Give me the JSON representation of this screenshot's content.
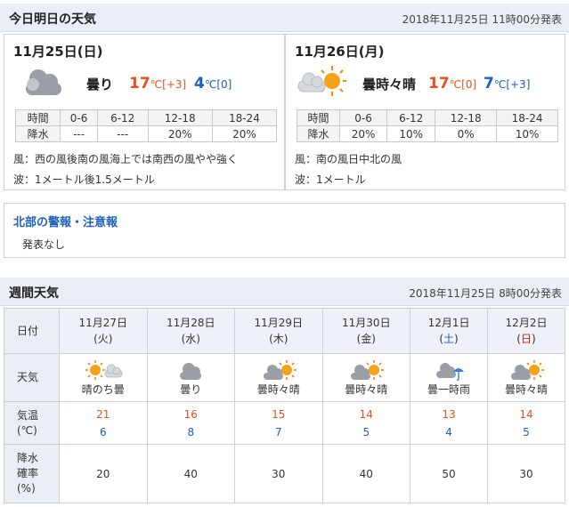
{
  "today": {
    "header_title": "今日明日の天気",
    "header_date": "2018年11月25日 11時00分発表",
    "days": [
      {
        "date": "11月25日(日)",
        "icon": "cloudy-icon",
        "weather": "曇り",
        "high": "17",
        "high_unit": "℃[+3]",
        "low": "4",
        "low_unit": "℃[0]",
        "rain_table": {
          "time_label": "時間",
          "rain_label": "降水",
          "slots": [
            "0-6",
            "6-12",
            "12-18",
            "18-24"
          ],
          "values": [
            "---",
            "---",
            "20%",
            "20%"
          ]
        },
        "wind": "風：西の風後南の風海上では南西の風やや強く",
        "wave": "波：1メートル後1.5メートル"
      },
      {
        "date": "11月26日(月)",
        "icon": "cloudy-sunny-icon",
        "weather": "曇時々晴",
        "high": "17",
        "high_unit": "℃[0]",
        "low": "7",
        "low_unit": "℃[+3]",
        "rain_table": {
          "time_label": "時間",
          "rain_label": "降水",
          "slots": [
            "0-6",
            "6-12",
            "12-18",
            "18-24"
          ],
          "values": [
            "20%",
            "10%",
            "0%",
            "10%"
          ]
        },
        "wind": "風：南の風日中北の風",
        "wave": "波：1メートル"
      }
    ]
  },
  "warning": {
    "title": "北部の警報・注意報",
    "text": "発表なし"
  },
  "weekly": {
    "header_title": "週間天気",
    "header_date": "2018年11月25日 8時00分発表",
    "row_labels": {
      "date": "日付",
      "weather": "天気",
      "temp_line1": "気温",
      "temp_line2": "(℃)",
      "pop_line1": "降水",
      "pop_line2": "確率",
      "pop_line3": "(%)"
    },
    "days": [
      {
        "date": "11月27日",
        "dow": "(火)",
        "dow_type": "weekday",
        "icon": "sunny-then-cloudy-icon",
        "weather": "晴のち曇",
        "high": "21",
        "low": "6",
        "pop": "20"
      },
      {
        "date": "11月28日",
        "dow": "(水)",
        "dow_type": "weekday",
        "icon": "cloudy-icon",
        "weather": "曇り",
        "high": "16",
        "low": "8",
        "pop": "40"
      },
      {
        "date": "11月29日",
        "dow": "(木)",
        "dow_type": "weekday",
        "icon": "cloudy-sunny-icon",
        "weather": "曇時々晴",
        "high": "15",
        "low": "7",
        "pop": "30"
      },
      {
        "date": "11月30日",
        "dow": "(金)",
        "dow_type": "weekday",
        "icon": "cloudy-sunny-icon",
        "weather": "曇時々晴",
        "high": "14",
        "low": "5",
        "pop": "40"
      },
      {
        "date": "12月1日",
        "dow": "(土)",
        "dow_type": "saturday",
        "icon": "cloudy-rain-icon",
        "weather": "曇一時雨",
        "high": "13",
        "low": "4",
        "pop": "50"
      },
      {
        "date": "12月2日",
        "dow": "(日)",
        "dow_type": "sunday",
        "icon": "cloudy-sunny-icon",
        "weather": "曇時々晴",
        "high": "14",
        "low": "5",
        "pop": "30"
      }
    ]
  },
  "colors": {
    "high_temp": "#e8511f",
    "low_temp": "#1f5fbf",
    "header_bg": "#eaeef5",
    "link_blue": "#1f5fbf",
    "sunday": "#d62020"
  }
}
